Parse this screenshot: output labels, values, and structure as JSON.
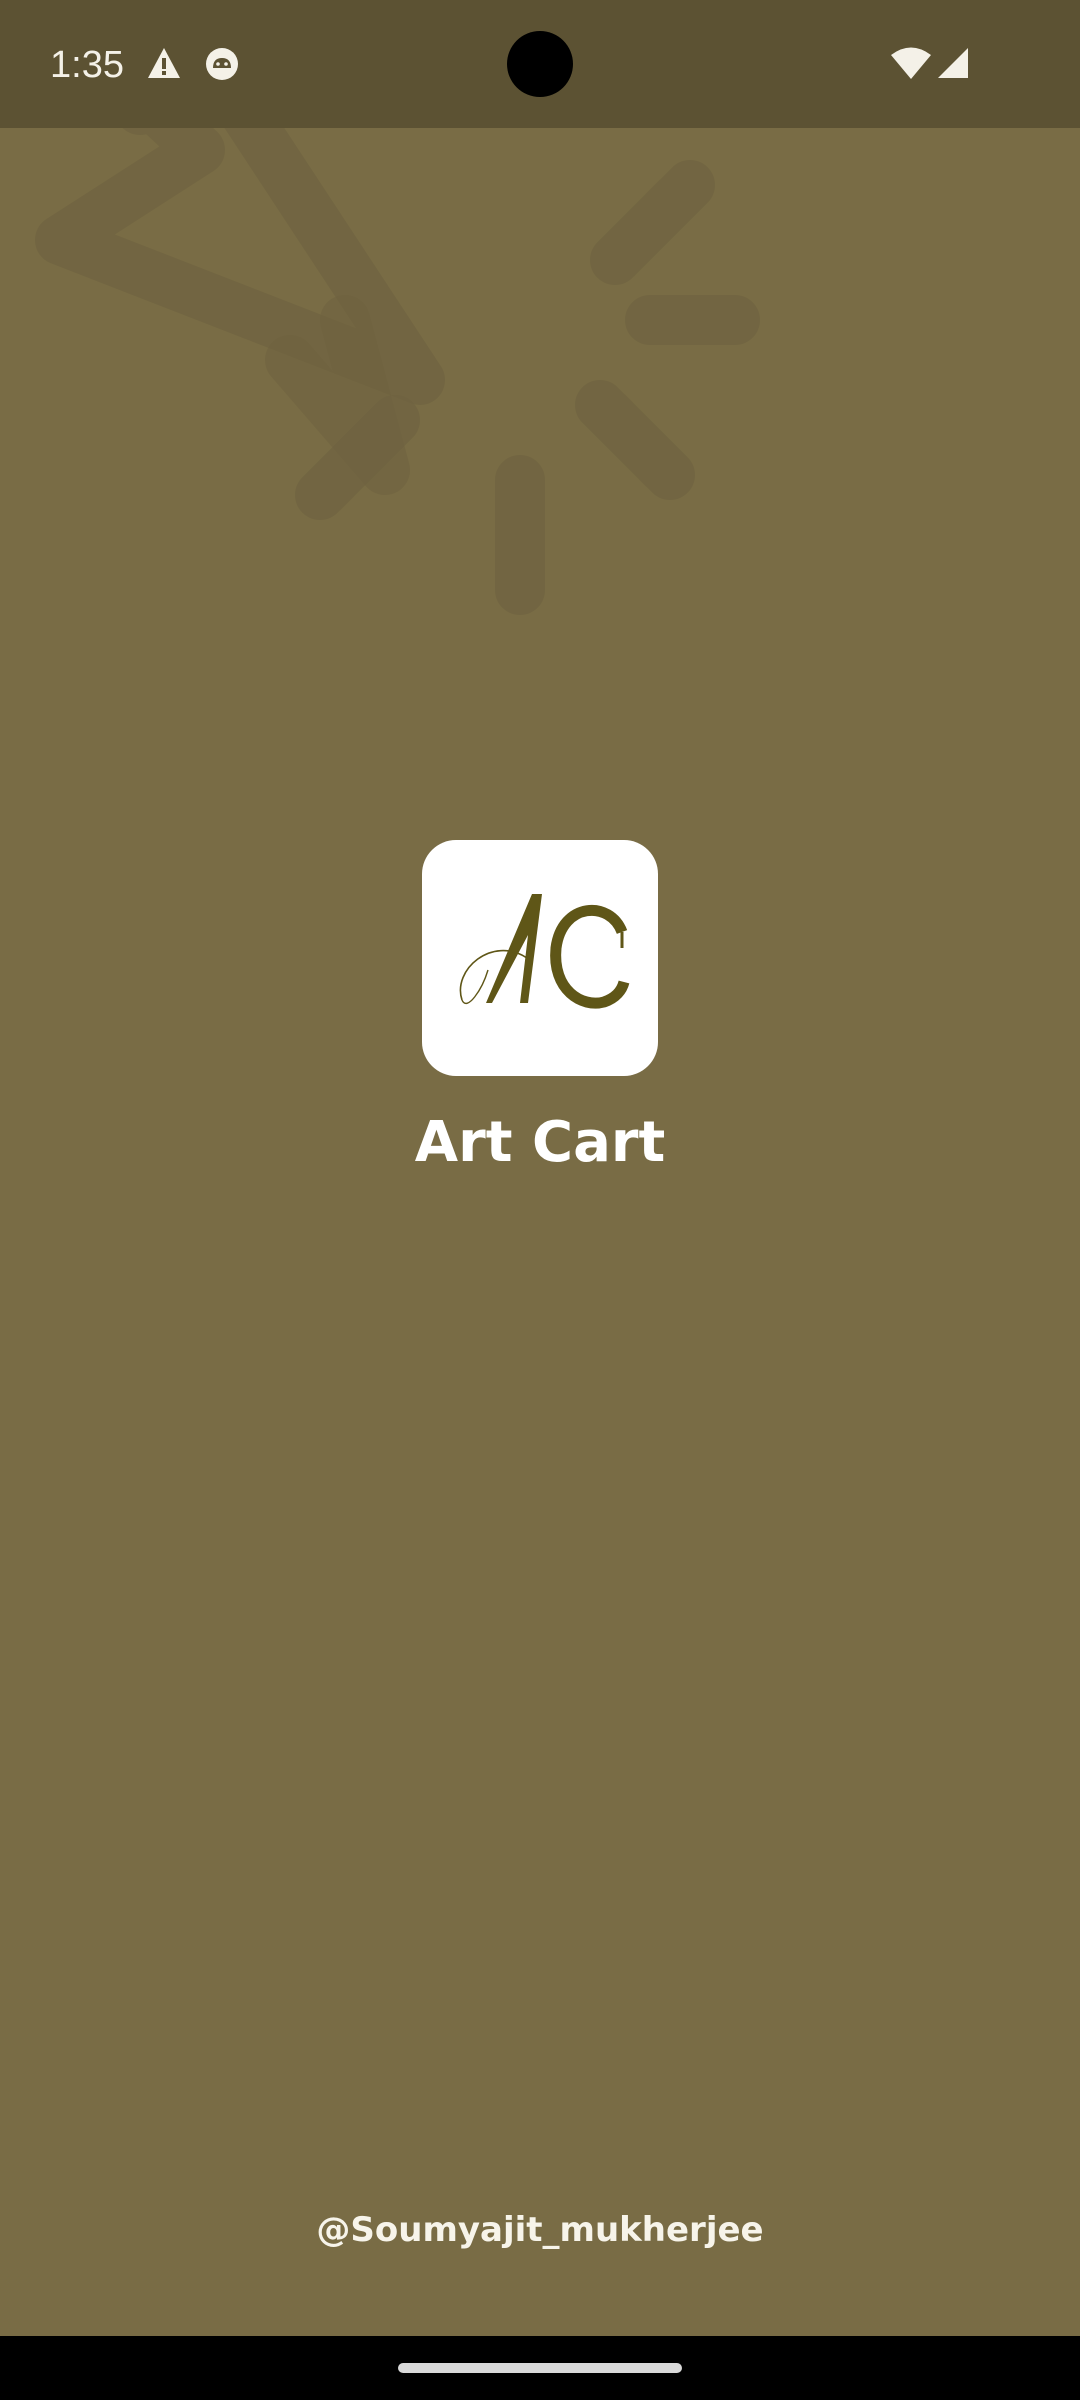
{
  "status_bar": {
    "time": "1:35",
    "left_icons": [
      "warning-icon",
      "android-debug-icon"
    ],
    "right_icons": [
      "wifi-icon",
      "cell-signal-icon"
    ]
  },
  "splash": {
    "logo_monogram": "AC",
    "app_name": "Art Cart",
    "credit": "@Soumyajit_mukherjee"
  },
  "colors": {
    "background": "#796c45",
    "status_bar": "#5c5233",
    "logo_tile": "#ffffff",
    "logo_ink": "#5f5617",
    "text": "#ffffff"
  }
}
